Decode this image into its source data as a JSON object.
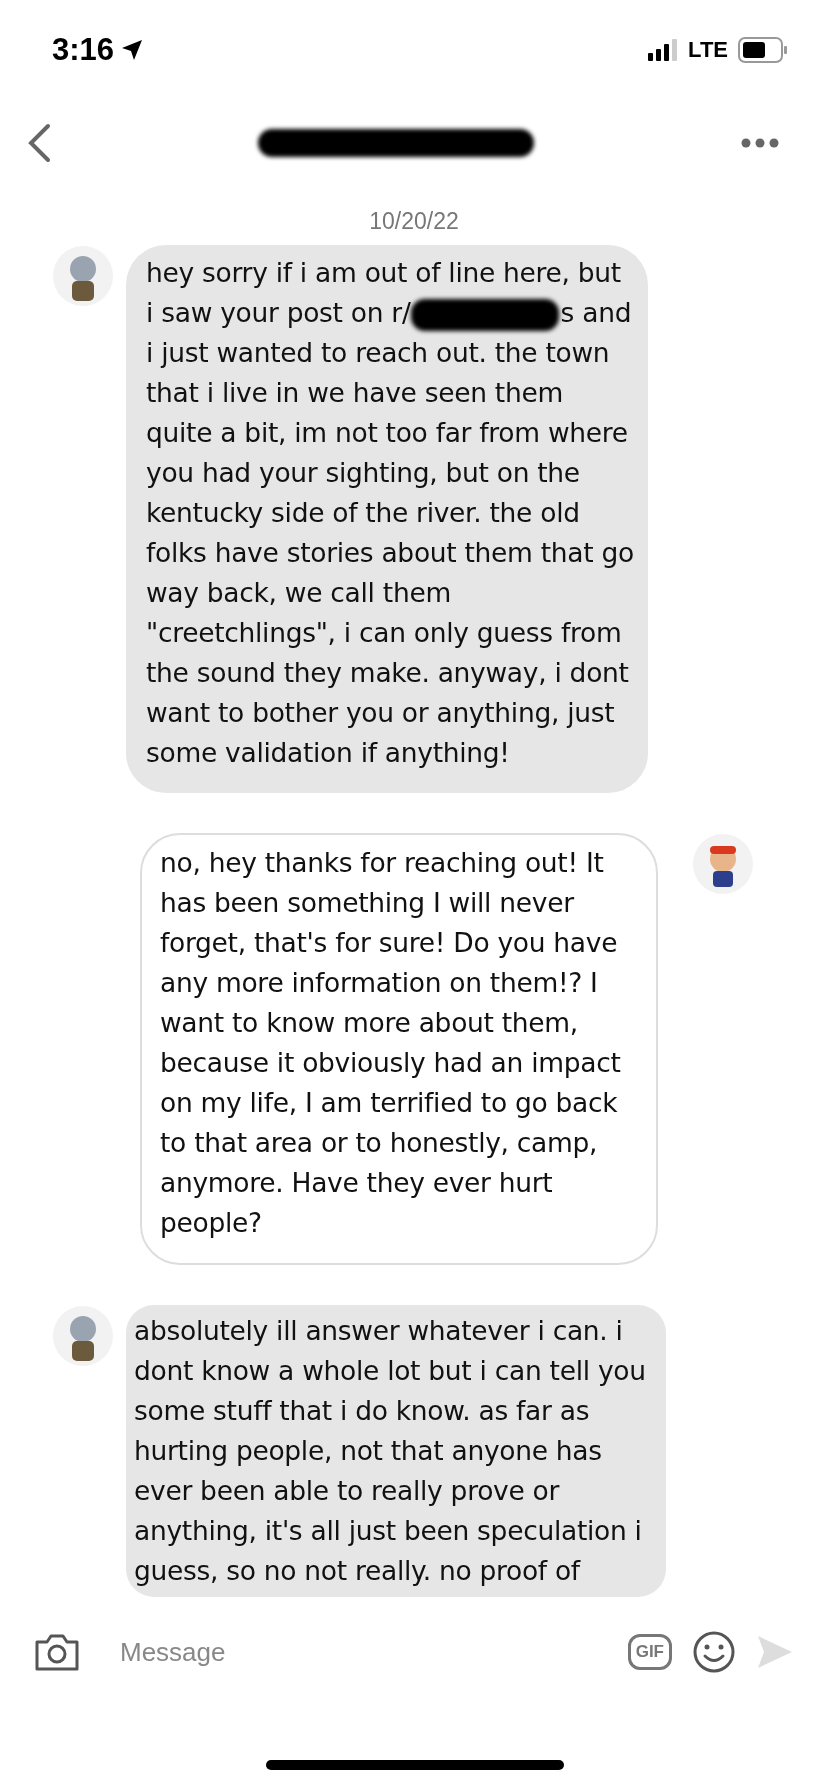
{
  "status_bar": {
    "time": "3:16",
    "network": "LTE"
  },
  "header": {
    "title_redacted": true
  },
  "date": "10/20/22",
  "messages": [
    {
      "kind": "received",
      "before": "hey sorry if i am out of line here, but i saw your post on r/",
      "redacted": true,
      "after": "s and i just wanted to reach out.  the town that i live in we have seen them quite a bit, im not too far from where you had your sighting, but on the kentucky side of the river.  the old folks have stories about them that go way back, we call them \"creetchlings\", i can only guess from the sound they make. anyway, i dont want to bother you or anything, just some validation if anything!"
    },
    {
      "kind": "sent",
      "before": "no, hey thanks for reaching out!  It has been something I will never forget, that's for sure!  Do you have any more information on them!?  I want to know more about them, because it obviously had an impact on my life, I am terrified to go back to that area or to honestly, camp, anymore.  Have they ever hurt people?",
      "redacted": false
    },
    {
      "kind": "received",
      "before": "absolutely ill answer whatever i can.  i dont know a whole lot but i can tell you some stuff that i do know. as far as hurting people, not that anyone has ever been able to really prove or anything, it's all just been speculation i guess, so no not really.  no proof of",
      "redacted": false
    }
  ],
  "composer": {
    "placeholder": "Message",
    "gif_label": "GIF"
  }
}
